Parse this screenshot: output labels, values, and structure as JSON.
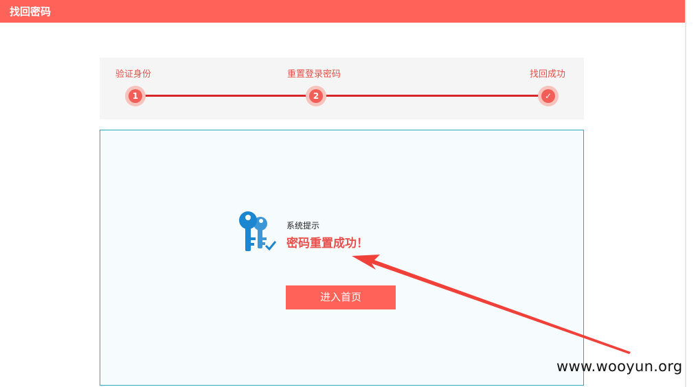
{
  "header": {
    "title": "找回密码"
  },
  "steps": [
    {
      "label": "验证身份",
      "marker": "1"
    },
    {
      "label": "重置登录密码",
      "marker": "2"
    },
    {
      "label": "找回成功",
      "marker": "✓"
    }
  ],
  "result": {
    "system_label": "系统提示",
    "message": "密码重置成功！",
    "home_button": "进入首页"
  },
  "watermark": "www.wooyun.org",
  "colors": {
    "accent": "#ff6258",
    "progress_line": "#d6262a",
    "panel_border": "#2aa9b2",
    "key_icon": "#1d86d0",
    "annotation_arrow": "#f0403a"
  },
  "icons": {
    "key": "key-icon",
    "check": "check-icon"
  }
}
